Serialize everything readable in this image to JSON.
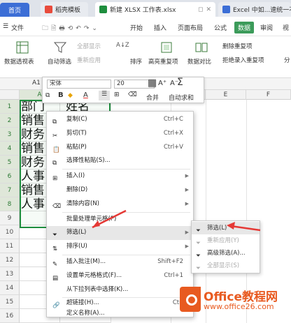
{
  "tabbar": {
    "home": "首页",
    "template": "稻壳模板",
    "file": "新建 XLSX 工作表.xlsx",
    "other": "Excel 中如...速统一不规范"
  },
  "menubar": {
    "file": "文件",
    "items": [
      "开始",
      "插入",
      "页面布局",
      "公式",
      "数据",
      "审阅",
      "视"
    ],
    "active": "数据"
  },
  "ribbon": {
    "pivot": "数据透视表",
    "autofilter": "自动筛选",
    "show_all": "全部显示",
    "reapply": "重新应用",
    "sort": "排序",
    "highlight_dup": "高亮重复项",
    "data_compare": "数据对比",
    "remove_dup": "删除重复项",
    "reject_dup": "拒绝录入重复项",
    "more": "分"
  },
  "formula_bar": {
    "cell_ref": "A1"
  },
  "mini_toolbar": {
    "font": "宋体",
    "size": "20",
    "grow": "A⁺",
    "shrink": "A⁻",
    "merge": "合并",
    "autosum": "自动求和"
  },
  "grid": {
    "columns": [
      "A",
      "B",
      "C",
      "D",
      "E",
      "F"
    ],
    "rows": [
      {
        "num": "1",
        "a": "部门",
        "b": "姓名"
      },
      {
        "num": "2",
        "a": "销售",
        "b": ""
      },
      {
        "num": "3",
        "a": "财务",
        "b": ""
      },
      {
        "num": "4",
        "a": "销售",
        "b": ""
      },
      {
        "num": "5",
        "a": "财务",
        "b": ""
      },
      {
        "num": "6",
        "a": "人事",
        "b": ""
      },
      {
        "num": "7",
        "a": "销售",
        "b": ""
      },
      {
        "num": "8",
        "a": "人事",
        "b": ""
      },
      {
        "num": "9",
        "a": "",
        "b": ""
      },
      {
        "num": "10",
        "a": "",
        "b": ""
      },
      {
        "num": "11",
        "a": "",
        "b": ""
      },
      {
        "num": "12",
        "a": "",
        "b": ""
      },
      {
        "num": "13",
        "a": "",
        "b": ""
      },
      {
        "num": "14",
        "a": "",
        "b": ""
      },
      {
        "num": "15",
        "a": "",
        "b": ""
      },
      {
        "num": "16",
        "a": "",
        "b": ""
      }
    ]
  },
  "context_menu": {
    "copy": "复制(C)",
    "copy_sc": "Ctrl+C",
    "cut": "剪切(T)",
    "cut_sc": "Ctrl+X",
    "paste": "粘贴(P)",
    "paste_sc": "Ctrl+V",
    "paste_special": "选择性粘贴(S)...",
    "insert": "插入(I)",
    "delete": "删除(D)",
    "clear": "清除内容(N)",
    "batch": "批量处理单元格(P)",
    "filter": "筛选(L)",
    "sort": "排序(U)",
    "comment": "插入批注(M)...",
    "comment_sc": "Shift+F2",
    "format": "设置单元格格式(F)...",
    "format_sc": "Ctrl+1",
    "dropdown": "从下拉列表中选择(K)...",
    "link": "超链接(H)...",
    "link_sc": "Ctrl",
    "define_name": "定义名称(A)..."
  },
  "submenu": {
    "filter": "筛选(L)",
    "reapply": "重新应用(Y)",
    "advanced": "高级筛选(A)...",
    "show_all": "全部显示(S)"
  },
  "watermark": {
    "title": "Office教程网",
    "url": "www.office26.com"
  },
  "colors": {
    "accent_green": "#1e8e3e",
    "tab_blue": "#3c6ed6",
    "arrow_red": "#e53935",
    "watermark_orange": "#e85a20"
  }
}
